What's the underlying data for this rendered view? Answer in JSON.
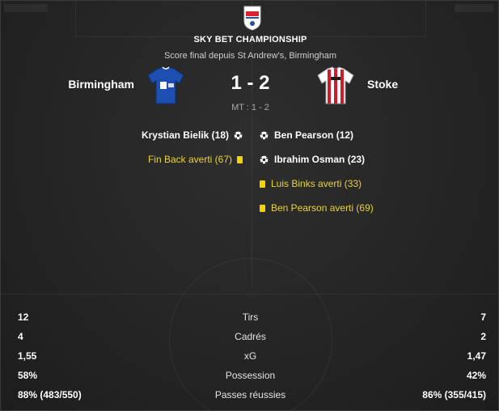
{
  "header": {
    "competition": "SKY BET CHAMPIONSHIP",
    "venue": "Score final depuis St Andrew's, Birmingham",
    "home_team": "Birmingham",
    "away_team": "Stoke",
    "score": "1 - 2",
    "half_time": "MT : 1 - 2"
  },
  "colors": {
    "card_yellow": "#f0d40b",
    "card_text": "#ecd23a",
    "home_kit": "#1d4fb0",
    "away_kit_red": "#d01c2a"
  },
  "events": {
    "home": [
      {
        "text": "Krystian Bielik (18)",
        "type": "goal",
        "icon": "football-icon"
      },
      {
        "text": "Fin Back averti (67)",
        "type": "yellow-card",
        "icon": "yellow-card-icon"
      }
    ],
    "away": [
      {
        "text": "Ben Pearson (12)",
        "type": "goal",
        "icon": "football-icon"
      },
      {
        "text": "Ibrahim Osman (23)",
        "type": "goal",
        "icon": "football-icon"
      },
      {
        "text": "Luis Binks averti (33)",
        "type": "yellow-card",
        "icon": "yellow-card-icon"
      },
      {
        "text": "Ben Pearson averti (69)",
        "type": "yellow-card",
        "icon": "yellow-card-icon"
      }
    ]
  },
  "stats": [
    {
      "label": "Tirs",
      "home": "12",
      "away": "7"
    },
    {
      "label": "Cadrés",
      "home": "4",
      "away": "2"
    },
    {
      "label": "xG",
      "home": "1,55",
      "away": "1,47"
    },
    {
      "label": "Possession",
      "home": "58%",
      "away": "42%"
    },
    {
      "label": "Passes réussies",
      "home": "88% (483/550)",
      "away": "86% (355/415)"
    }
  ]
}
